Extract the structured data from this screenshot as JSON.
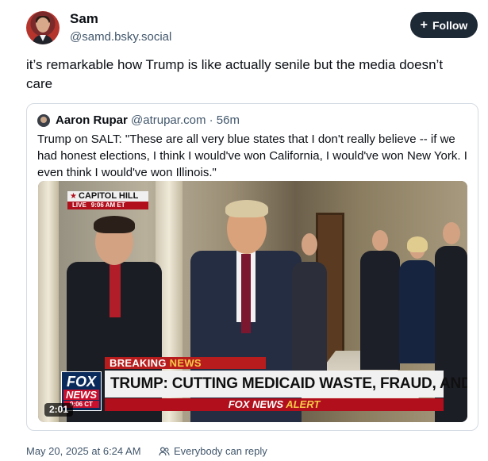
{
  "author": {
    "display_name": "Sam",
    "handle": "@samd.bsky.social"
  },
  "follow_button": {
    "icon": "plus-icon",
    "label": "Follow"
  },
  "post": {
    "text": "it’s remarkable how Trump is like actually senile but the media doesn’t care",
    "date": "May 20, 2025 at 6:24 AM",
    "reply_permission": "Everybody can reply"
  },
  "quoted_post": {
    "display_name": "Aaron Rupar",
    "handle": "@atrupar.com",
    "separator": "·",
    "time": "56m",
    "text": "Trump on SALT: \"These are all very blue states that I don't really believe -- if we had honest elections, I think I would've won California, I would've won New York. I even think I would've won Illinois.\"",
    "video": {
      "duration": "2:01",
      "location_tag": "CAPITOL HILL",
      "live_label": "LIVE",
      "live_time": "9:06 AM ET",
      "banner_prefix": "BREAKING",
      "banner_highlight": "NEWS",
      "headline": "TRUMP: CUTTING MEDICAID WASTE, FRAUD, AND ABUSE",
      "alert_prefix": "FOX NEWS",
      "alert_highlight": "ALERT",
      "logo_top": "FOX",
      "logo_bottom": "NEWS",
      "logo_clock": "9:06 CT"
    }
  },
  "colors": {
    "follow_bg": "#1e2936",
    "text_primary": "#0b0f14",
    "text_secondary": "#42576c",
    "quote_border": "#d4dbe2",
    "fox_red": "#b10f1c",
    "fox_yellow": "#f7c948"
  }
}
